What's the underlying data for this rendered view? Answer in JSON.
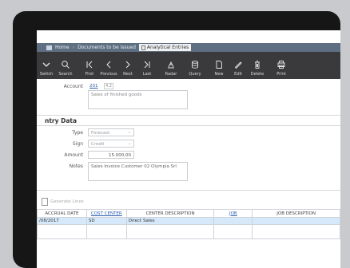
{
  "breadcrumb": {
    "home": "Home",
    "documents": "Documents to be Issued",
    "current": "Analytical Entries"
  },
  "toolbar": {
    "buttons": [
      {
        "label": "Switch",
        "icon": "switch-icon"
      },
      {
        "label": "Search",
        "icon": "search-icon"
      },
      {
        "label": "First",
        "icon": "first-icon"
      },
      {
        "label": "Previous",
        "icon": "previous-icon"
      },
      {
        "label": "Next",
        "icon": "next-icon"
      },
      {
        "label": "Last",
        "icon": "last-icon"
      },
      {
        "label": "Radar",
        "icon": "radar-icon"
      },
      {
        "label": "Query",
        "icon": "database-icon"
      },
      {
        "label": "New",
        "icon": "new-document-icon"
      },
      {
        "label": "Edit",
        "icon": "pencil-icon"
      },
      {
        "label": "Delete",
        "icon": "trash-icon"
      },
      {
        "label": "Print",
        "icon": "printer-icon"
      }
    ]
  },
  "account": {
    "label": "Account",
    "code": "201",
    "sub": "4.2",
    "description": "Sales of finished goods"
  },
  "entry_data": {
    "title": "ntry Data",
    "type_label": "Type",
    "type_value": "Forecast",
    "sign_label": "Sign",
    "sign_value": "Credit",
    "amount_label": "Amount",
    "amount_value": "15.000,00",
    "notes_label": "Notes",
    "notes_value": "Sales Invoice Customer 02 Olympia Srl"
  },
  "generate_lines": "Generate Lines",
  "table": {
    "headers": [
      "ACCRUAL DATE",
      "COST CENTER",
      "CENTER DESCRIPTION",
      "JOB",
      "JOB DESCRIPTION"
    ],
    "rows": [
      [
        "/08/2017",
        "SD",
        "Direct Sales",
        "",
        ""
      ]
    ]
  }
}
